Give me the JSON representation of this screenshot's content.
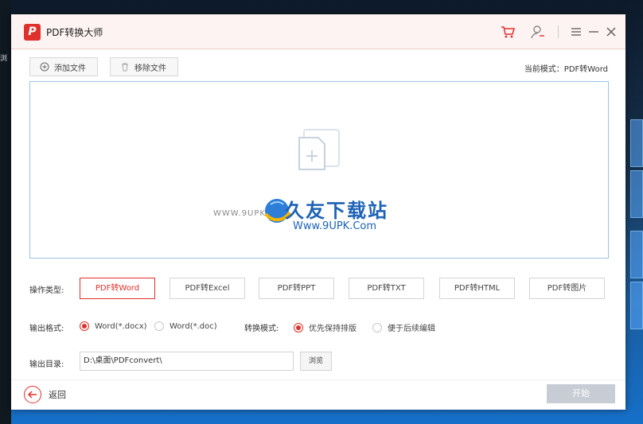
{
  "desktop": {
    "left_label": "浏"
  },
  "window": {
    "title": "PDF转换大师",
    "logo_text": "P",
    "accent_color": "#e0302b",
    "titlebar_icons": [
      "cart-icon",
      "user-icon",
      "menu-icon",
      "minimize-icon",
      "close-icon"
    ]
  },
  "toolbar": {
    "add_files": "添加文件",
    "remove_files": "移除文件",
    "current_mode": "当前模式：PDF转Word"
  },
  "dropzone": {
    "watermark_title": "久友下载站",
    "watermark_url": "Www.9UPK.Com",
    "watermark_small": "WWW.9UPK.COM"
  },
  "operation": {
    "label": "操作类型:",
    "options": [
      "PDF转Word",
      "PDF转Excel",
      "PDF转PPT",
      "PDF转TXT",
      "PDF转HTML",
      "PDF转图片"
    ],
    "selected": "PDF转Word"
  },
  "output_format": {
    "label": "输出格式:",
    "options": [
      "Word(*.docx)",
      "Word(*.doc)"
    ],
    "selected": "Word(*.docx)"
  },
  "convert_mode": {
    "label": "转换模式:",
    "options": [
      "优先保持排版",
      "便于后续编辑"
    ],
    "selected": "优先保持排版"
  },
  "output_dir": {
    "label": "输出目录:",
    "value": "D:\\桌面\\PDFconvert\\",
    "browse": "浏览"
  },
  "footer": {
    "back": "返回",
    "start": "开始"
  }
}
